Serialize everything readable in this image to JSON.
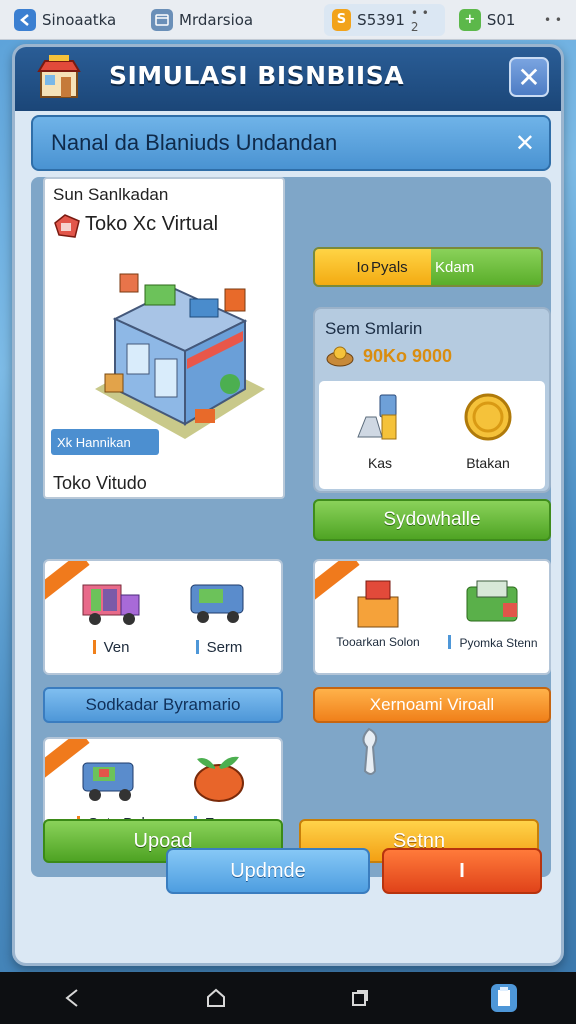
{
  "tabs": [
    {
      "label": "Sinoaatka",
      "icon": "left-arrow-icon",
      "color": "#3b7fd1"
    },
    {
      "label": "Mrdarsioa",
      "icon": "window-icon",
      "color": "#6a8fb8"
    },
    {
      "label": "S5391",
      "icon": "coin-app-icon",
      "color": "#f2a31b",
      "menu": "• • 2"
    },
    {
      "label": "S01",
      "icon": "plus-app-icon",
      "color": "#5cb84a",
      "menu": "• •"
    }
  ],
  "dialog": {
    "title": "SIMULASI BISNBIISA",
    "close_label": "✕",
    "subheader": "Nanal da Blaniuds Undandan",
    "subheader_close": "✕"
  },
  "shop": {
    "header": "Sun Sanlkadan",
    "name": "Toko Xc Virtual",
    "chip": "Xk Hannikan",
    "footer": "Toko Vitudo"
  },
  "toggle": {
    "a": "Io",
    "b": "Pyals",
    "c": "Kdam"
  },
  "sim": {
    "title": "Sem Smlarin",
    "value": "90Ko 9000",
    "items": [
      "Kas",
      "Btakan"
    ],
    "button": "Sydowhalle"
  },
  "cards": {
    "vehicles": {
      "items": [
        "Ven",
        "Serm"
      ]
    },
    "goods": {
      "items": [
        "Tooarkan Solon",
        "Pyomka Stenn"
      ]
    },
    "market": {
      "items": [
        "Sota Bal",
        "Fapor"
      ]
    }
  },
  "buttons": {
    "blue_pill": "Sodkadar Byramario",
    "orange_pill": "Xernoami Viroall",
    "green": "Upoad",
    "yellow": "Setnn",
    "footer_blue": "Updmde",
    "footer_red": "I"
  },
  "colors": {
    "accent": "#2a5d96",
    "green": "#5aae2a",
    "orange": "#f0801a",
    "yellow": "#f3ab12"
  }
}
